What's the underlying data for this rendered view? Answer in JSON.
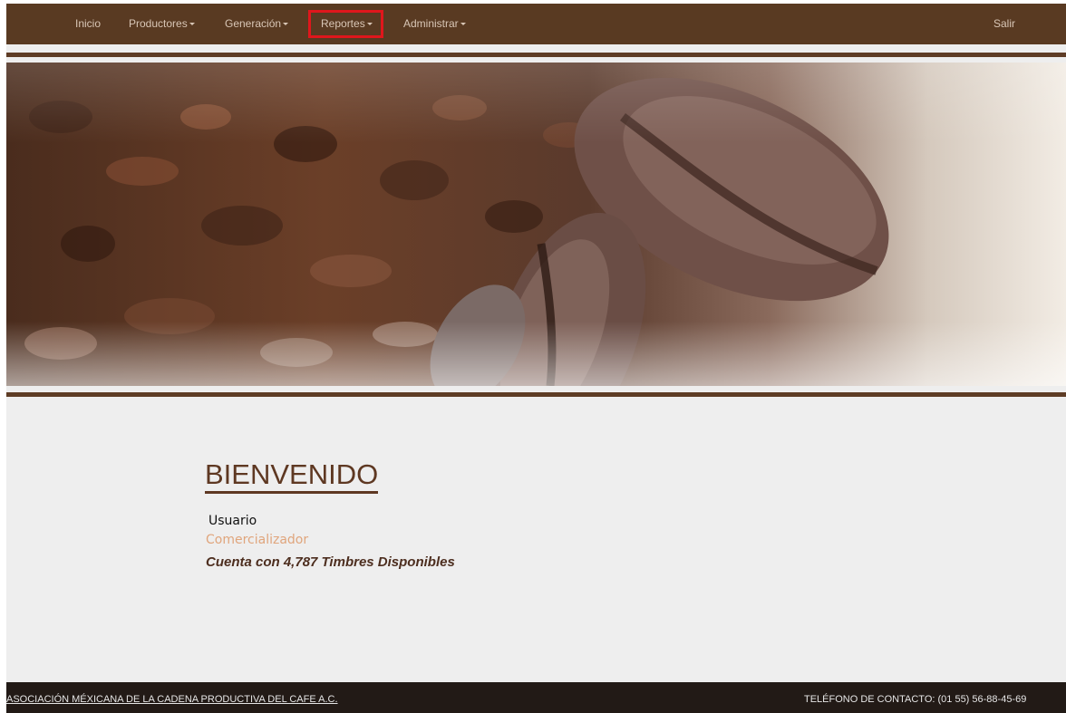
{
  "navbar": {
    "items": [
      {
        "label": "Inicio",
        "dropdown": false
      },
      {
        "label": "Productores",
        "dropdown": true
      },
      {
        "label": "Generación",
        "dropdown": true
      },
      {
        "label": "Reportes",
        "dropdown": true
      },
      {
        "label": "Administrar",
        "dropdown": true
      }
    ],
    "logout_label": "Salir",
    "highlighted_item": "Reportes",
    "colors": {
      "background": "#593a22",
      "text": "#d8c6b6",
      "highlight_border": "#e0161c"
    }
  },
  "hero": {
    "image": "coffee-beans-banner"
  },
  "welcome": {
    "title": "BIENVENIDO",
    "user": "Usuario",
    "role": "Comercializador",
    "stamps_text": "Cuenta con 4,787 Timbres Disponibles"
  },
  "footer": {
    "org_link": "ASOCIACIÓN MÉXICANA DE LA CADENA PRODUCTIVA DEL CAFE A.C.",
    "contact": "TELÉFONO DE CONTACTO: (01 55) 56-88-45-69"
  },
  "colors": {
    "accent": "#5e3822",
    "role": "#e0a57c",
    "footer_bg": "#221a16",
    "page_bg": "#eeeeee"
  }
}
